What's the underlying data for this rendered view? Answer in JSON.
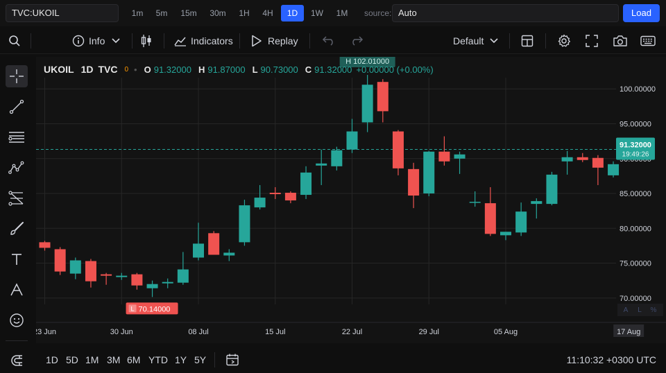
{
  "topbar": {
    "symbol": "TVC:UKOIL",
    "intervals": [
      "1m",
      "5m",
      "15m",
      "30m",
      "1H",
      "4H",
      "1D",
      "1W",
      "1M"
    ],
    "active_interval": "1D",
    "source_label": "source:",
    "source_value": "Auto",
    "load_label": "Load"
  },
  "toolbar": {
    "info_label": "Info",
    "indicators_label": "Indicators",
    "replay_label": "Replay",
    "layout_label": "Default",
    "icons": [
      "search-icon",
      "info-icon",
      "chevron-down-icon",
      "candles-icon",
      "indicators-icon",
      "play-icon",
      "undo-icon",
      "redo-icon",
      "layout-icon",
      "gear-icon",
      "fullscreen-icon",
      "camera-icon",
      "keyboard-icon"
    ]
  },
  "leftbar": {
    "tools": [
      "crosshair-icon",
      "trendline-icon",
      "fib-lines-icon",
      "pattern-icon",
      "forecast-icon",
      "brush-icon",
      "text-icon",
      "measure-icon",
      "emoji-icon",
      "magnet-icon"
    ]
  },
  "legend": {
    "symbol": "UKOIL",
    "interval": "1D",
    "exchange": "TVC",
    "zero": "0",
    "open_label": "O",
    "open": "91.32000",
    "high_label": "H",
    "high": "91.87000",
    "low_label": "L",
    "low": "90.73000",
    "close_label": "C",
    "close": "91.32000",
    "change": "+0.00000 (+0.00%)"
  },
  "markers": {
    "high_marker": "H 102.01000",
    "low_marker_tag": "L",
    "low_marker": "70.14000"
  },
  "price_badge": {
    "price": "91.32000",
    "countdown": "19:49:26"
  },
  "scale_buttons": [
    "A",
    "L",
    "%"
  ],
  "chart_data": {
    "type": "candlestick",
    "y_ticks": [
      "100.00000",
      "95.00000",
      "90.00000",
      "85.00000",
      "80.00000",
      "75.00000",
      "70.00000"
    ],
    "y_tick_values": [
      100,
      95,
      90,
      85,
      80,
      75,
      70
    ],
    "ylim": [
      66.5,
      104.6
    ],
    "x_ticks": [
      "23 Jun",
      "30 Jun",
      "08 Jul",
      "15 Jul",
      "22 Jul",
      "29 Jul",
      "05 Aug",
      "17 Aug"
    ],
    "x_tick_index": [
      0,
      5,
      10,
      15,
      20,
      25,
      30,
      38
    ],
    "current_price": 91.32,
    "colors": {
      "up": "#26a69a",
      "down": "#ef5350",
      "grid": "#262626",
      "bg": "#131313"
    },
    "candles": [
      {
        "o": 78.0,
        "h": 78.2,
        "l": 76.8,
        "c": 77.2
      },
      {
        "o": 77.0,
        "h": 77.3,
        "l": 73.3,
        "c": 73.8
      },
      {
        "o": 73.5,
        "h": 75.8,
        "l": 72.7,
        "c": 75.4
      },
      {
        "o": 75.3,
        "h": 75.6,
        "l": 71.5,
        "c": 72.4
      },
      {
        "o": 73.4,
        "h": 73.6,
        "l": 71.9,
        "c": 73.2
      },
      {
        "o": 73.0,
        "h": 73.6,
        "l": 72.6,
        "c": 73.2
      },
      {
        "o": 73.4,
        "h": 73.6,
        "l": 71.2,
        "c": 71.8
      },
      {
        "o": 71.4,
        "h": 72.5,
        "l": 70.14,
        "c": 72.0
      },
      {
        "o": 72.1,
        "h": 72.8,
        "l": 71.4,
        "c": 72.3
      },
      {
        "o": 72.2,
        "h": 76.6,
        "l": 71.9,
        "c": 74.1
      },
      {
        "o": 75.8,
        "h": 80.8,
        "l": 75.4,
        "c": 77.8
      },
      {
        "o": 79.3,
        "h": 79.6,
        "l": 76.3,
        "c": 76.2
      },
      {
        "o": 76.1,
        "h": 77.0,
        "l": 75.3,
        "c": 76.5
      },
      {
        "o": 78.0,
        "h": 84.1,
        "l": 77.5,
        "c": 83.3
      },
      {
        "o": 83.0,
        "h": 86.2,
        "l": 82.7,
        "c": 84.4
      },
      {
        "o": 85.1,
        "h": 85.9,
        "l": 84.2,
        "c": 84.9
      },
      {
        "o": 85.1,
        "h": 85.3,
        "l": 83.6,
        "c": 84.0
      },
      {
        "o": 84.8,
        "h": 88.9,
        "l": 84.2,
        "c": 88.0
      },
      {
        "o": 89.0,
        "h": 91.3,
        "l": 86.2,
        "c": 89.3
      },
      {
        "o": 88.9,
        "h": 91.7,
        "l": 88.3,
        "c": 91.2
      },
      {
        "o": 91.3,
        "h": 95.7,
        "l": 90.8,
        "c": 93.9
      },
      {
        "o": 95.2,
        "h": 102.01,
        "l": 93.8,
        "c": 100.6
      },
      {
        "o": 101.0,
        "h": 101.4,
        "l": 95.2,
        "c": 96.8
      },
      {
        "o": 93.9,
        "h": 94.1,
        "l": 87.6,
        "c": 88.6
      },
      {
        "o": 88.5,
        "h": 89.4,
        "l": 82.9,
        "c": 84.7
      },
      {
        "o": 85.0,
        "h": 91.1,
        "l": 84.6,
        "c": 91.0
      },
      {
        "o": 91.0,
        "h": 93.2,
        "l": 89.0,
        "c": 89.6
      },
      {
        "o": 90.0,
        "h": 91.0,
        "l": 87.8,
        "c": 90.6
      },
      {
        "o": 83.7,
        "h": 85.3,
        "l": 83.1,
        "c": 83.8
      },
      {
        "o": 83.6,
        "h": 85.9,
        "l": 78.9,
        "c": 79.2
      },
      {
        "o": 79.0,
        "h": 79.5,
        "l": 78.3,
        "c": 79.5
      },
      {
        "o": 79.4,
        "h": 83.7,
        "l": 78.9,
        "c": 82.4
      },
      {
        "o": 83.5,
        "h": 84.3,
        "l": 81.4,
        "c": 83.9
      },
      {
        "o": 83.5,
        "h": 88.1,
        "l": 83.3,
        "c": 87.7
      },
      {
        "o": 89.6,
        "h": 91.1,
        "l": 87.7,
        "c": 90.2
      },
      {
        "o": 90.2,
        "h": 90.8,
        "l": 89.5,
        "c": 89.8
      },
      {
        "o": 90.1,
        "h": 90.5,
        "l": 86.2,
        "c": 88.7
      },
      {
        "o": 87.6,
        "h": 89.6,
        "l": 87.3,
        "c": 89.2
      }
    ]
  },
  "bottombar": {
    "ranges": [
      "1D",
      "5D",
      "1M",
      "3M",
      "6M",
      "YTD",
      "1Y",
      "5Y"
    ],
    "clock": "11:10:32 +0300 UTC"
  }
}
